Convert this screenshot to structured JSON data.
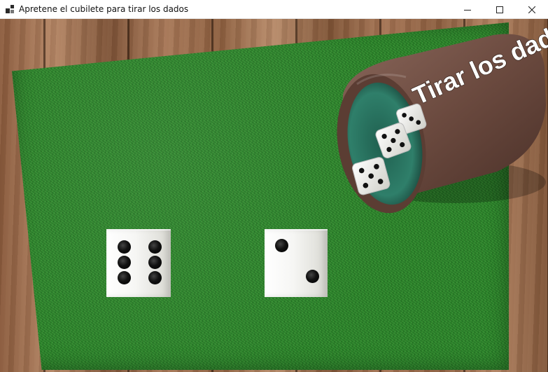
{
  "window": {
    "title": "Apretene el cubilete para tirar los dados"
  },
  "cup": {
    "label": "Tirar los dados!"
  },
  "dice": [
    {
      "value": 6
    },
    {
      "value": 2
    }
  ],
  "colors": {
    "felt": "#2f8a2e",
    "cup": "#6b4a3f",
    "cup_inner": "#2f7f6a",
    "pip": "#111111"
  },
  "icons": [
    "app-icon",
    "minimize-icon",
    "maximize-icon",
    "close-icon"
  ]
}
